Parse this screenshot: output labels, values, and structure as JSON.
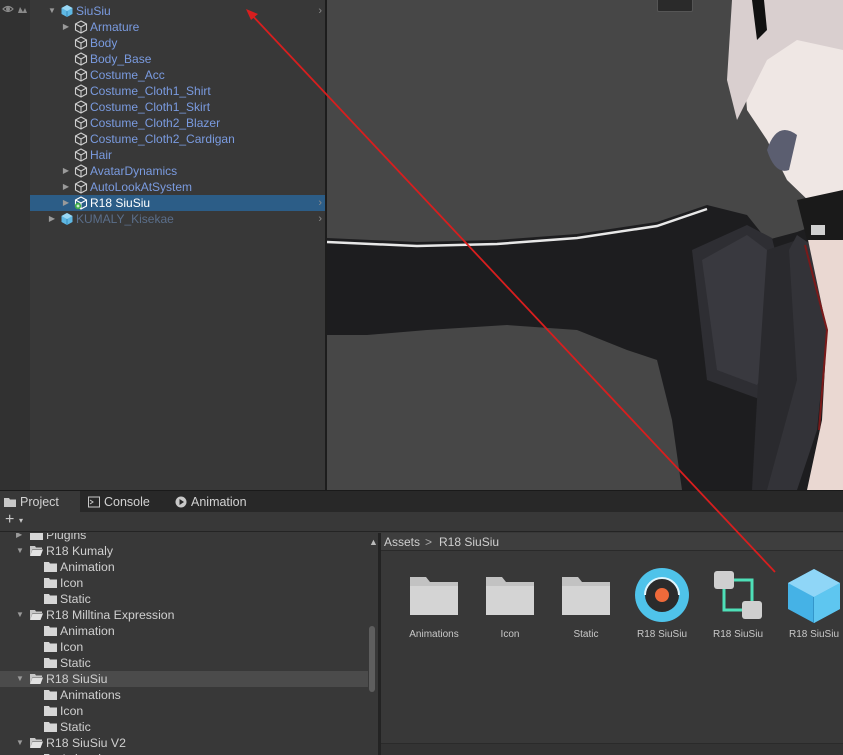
{
  "hierarchy": {
    "rows": [
      {
        "label": "SiuSiu",
        "depth": 0,
        "fold": "down",
        "icon": "prefab-icon",
        "kind": "root"
      },
      {
        "label": "Armature",
        "depth": 1,
        "fold": "right",
        "icon": "gameobject-icon",
        "kind": "child"
      },
      {
        "label": "Body",
        "depth": 1,
        "fold": "",
        "icon": "gameobject-icon",
        "kind": "child"
      },
      {
        "label": "Body_Base",
        "depth": 1,
        "fold": "",
        "icon": "gameobject-icon",
        "kind": "child"
      },
      {
        "label": "Costume_Acc",
        "depth": 1,
        "fold": "",
        "icon": "gameobject-icon",
        "kind": "child"
      },
      {
        "label": "Costume_Cloth1_Shirt",
        "depth": 1,
        "fold": "",
        "icon": "gameobject-icon",
        "kind": "child"
      },
      {
        "label": "Costume_Cloth1_Skirt",
        "depth": 1,
        "fold": "",
        "icon": "gameobject-icon",
        "kind": "child"
      },
      {
        "label": "Costume_Cloth2_Blazer",
        "depth": 1,
        "fold": "",
        "icon": "gameobject-icon",
        "kind": "child"
      },
      {
        "label": "Costume_Cloth2_Cardigan",
        "depth": 1,
        "fold": "",
        "icon": "gameobject-icon",
        "kind": "child"
      },
      {
        "label": "Hair",
        "depth": 1,
        "fold": "",
        "icon": "gameobject-icon",
        "kind": "child"
      },
      {
        "label": "AvatarDynamics",
        "depth": 1,
        "fold": "right",
        "icon": "gameobject-icon",
        "kind": "child"
      },
      {
        "label": "AutoLookAtSystem",
        "depth": 1,
        "fold": "right",
        "icon": "gameobject-icon",
        "kind": "child"
      },
      {
        "label": "R18 SiuSiu",
        "depth": 1,
        "fold": "right",
        "icon": "prefab-added-icon",
        "kind": "selected"
      },
      {
        "label": "KUMALY_Kisekae",
        "depth": 0,
        "fold": "right",
        "icon": "prefab-icon",
        "kind": "dim"
      }
    ]
  },
  "tabs": [
    {
      "label": "Project",
      "icon": "folder-icon",
      "active": true
    },
    {
      "label": "Console",
      "icon": "console-icon",
      "active": false
    },
    {
      "label": "Animation",
      "icon": "animation-icon",
      "active": false
    }
  ],
  "toolbar": {
    "add_label": "+",
    "add_dropdown": "▾"
  },
  "project_tree": {
    "rows": [
      {
        "label": "Plugins",
        "depth": 1,
        "fold": "right",
        "folder": "closed",
        "selected": false
      },
      {
        "label": "R18 Kumaly",
        "depth": 1,
        "fold": "down",
        "folder": "open",
        "selected": false
      },
      {
        "label": "Animation",
        "depth": 2,
        "fold": "",
        "folder": "closed",
        "selected": false
      },
      {
        "label": "Icon",
        "depth": 2,
        "fold": "",
        "folder": "closed",
        "selected": false
      },
      {
        "label": "Static",
        "depth": 2,
        "fold": "",
        "folder": "closed",
        "selected": false
      },
      {
        "label": "R18 Milltina Expression",
        "depth": 1,
        "fold": "down",
        "folder": "open",
        "selected": false
      },
      {
        "label": "Animation",
        "depth": 2,
        "fold": "",
        "folder": "closed",
        "selected": false
      },
      {
        "label": "Icon",
        "depth": 2,
        "fold": "",
        "folder": "closed",
        "selected": false
      },
      {
        "label": "Static",
        "depth": 2,
        "fold": "",
        "folder": "closed",
        "selected": false
      },
      {
        "label": "R18 SiuSiu",
        "depth": 1,
        "fold": "down",
        "folder": "open",
        "selected": true
      },
      {
        "label": "Animations",
        "depth": 2,
        "fold": "",
        "folder": "closed",
        "selected": false
      },
      {
        "label": "Icon",
        "depth": 2,
        "fold": "",
        "folder": "closed",
        "selected": false
      },
      {
        "label": "Static",
        "depth": 2,
        "fold": "",
        "folder": "closed",
        "selected": false
      },
      {
        "label": "R18 SiuSiu V2",
        "depth": 1,
        "fold": "down",
        "folder": "open",
        "selected": false
      },
      {
        "label": "Animation",
        "depth": 2,
        "fold": "",
        "folder": "closed",
        "selected": false
      }
    ]
  },
  "breadcrumb": {
    "root": "Assets",
    "separator": ">",
    "current": "R18 SiuSiu"
  },
  "assets": [
    {
      "label": "Animations",
      "icon": "folder-icon"
    },
    {
      "label": "Icon",
      "icon": "folder-icon"
    },
    {
      "label": "Static",
      "icon": "folder-icon"
    },
    {
      "label": "R18 SiuSiu",
      "icon": "avatar-descriptor-icon"
    },
    {
      "label": "R18 SiuSiu",
      "icon": "animator-controller-icon"
    },
    {
      "label": "R18 SiuSiu",
      "icon": "prefab-cube-icon"
    }
  ],
  "colors": {
    "selection": "#2c5d87",
    "hierarchy_text": "#7a9be0",
    "annotation_arrow": "#d81e1e",
    "prefab_blue": "#4fc3ea"
  }
}
